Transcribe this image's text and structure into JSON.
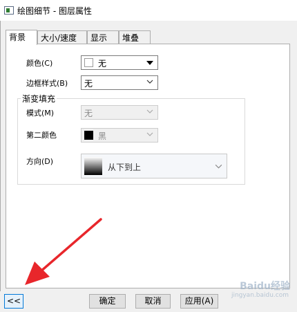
{
  "window": {
    "title": "绘图细节 - 图层属性"
  },
  "tabs": [
    {
      "label": "背景"
    },
    {
      "label": "大小/速度"
    },
    {
      "label": "显示"
    },
    {
      "label": "堆叠"
    }
  ],
  "background": {
    "color_label": "颜色(C)",
    "color_value": "无",
    "border_label": "边框样式(B)",
    "border_value": "无"
  },
  "gradient": {
    "group_title": "渐变填充",
    "mode_label": "模式(M)",
    "mode_value": "无",
    "second_color_label": "第二颜色",
    "second_color_value": "黑",
    "direction_label": "方向(D)",
    "direction_value": "从下到上"
  },
  "buttons": {
    "collapse": "<<",
    "ok": "确定",
    "cancel": "取消",
    "apply": "应用(A)"
  },
  "watermark": {
    "text": "Baidu经验",
    "sub": "jingyan.baidu.com"
  },
  "colors": {
    "annotation_arrow": "#e8262b",
    "focus_border": "#0078d7"
  }
}
